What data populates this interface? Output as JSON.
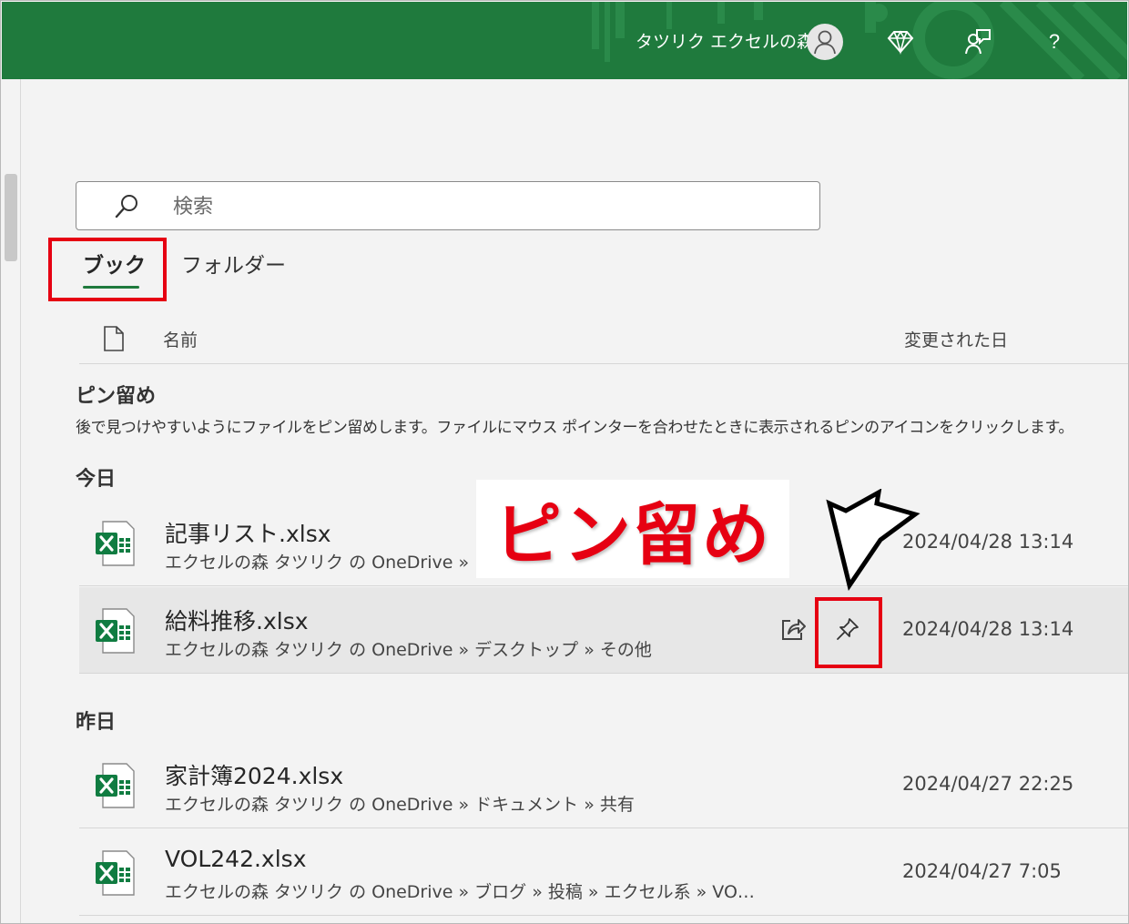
{
  "user": {
    "name": "タツリク エクセルの森"
  },
  "toolbar": {
    "help_label": "?",
    "icons": [
      "avatar-icon",
      "diamond-icon",
      "feedback-icon",
      "help-icon"
    ]
  },
  "search": {
    "placeholder": "検索"
  },
  "tabs": [
    {
      "label": "ブック",
      "selected": true
    },
    {
      "label": "フォルダー",
      "selected": false
    }
  ],
  "columns": {
    "name": "名前",
    "modified": "変更された日"
  },
  "pinned": {
    "title": "ピン留め",
    "description": "後で見つけやすいようにファイルをピン留めします。ファイルにマウス ポインターを合わせたときに表示されるピンのアイコンをクリックします。"
  },
  "groups": [
    {
      "title": "今日",
      "files": [
        {
          "name": "記事リスト.xlsx",
          "path": "エクセルの森 タツリク の OneDrive » ブログ",
          "modified": "2024/04/28 13:14"
        },
        {
          "name": "給料推移.xlsx",
          "path": "エクセルの森 タツリク の OneDrive » デスクトップ » その他",
          "modified": "2024/04/28 13:14"
        }
      ]
    },
    {
      "title": "昨日",
      "files": [
        {
          "name": "家計簿2024.xlsx",
          "path": "エクセルの森 タツリク の OneDrive » ドキュメント » 共有",
          "modified": "2024/04/27 22:25"
        },
        {
          "name": "VOL242.xlsx",
          "path": "エクセルの森 タツリク の OneDrive » ブログ » 投稿 » エクセル系 » VO…",
          "modified": "2024/04/27 7:05"
        }
      ]
    }
  ],
  "annotation": {
    "label": "ピン留め"
  },
  "colors": {
    "brand": "#1f7a3d",
    "highlight": "#e60012",
    "excel": "#107c41"
  }
}
